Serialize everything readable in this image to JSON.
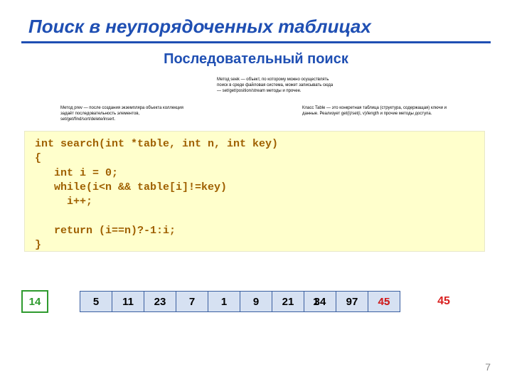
{
  "title": "Поиск в неупорядоченных таблицах",
  "subtitle": "Последовательный поиск",
  "smalltext_top": "Метод seek — объект, по которому можно осуществлять поиск в среде файловая система, может записывать сюда — set/get/position/stream методы и прочее.",
  "smalltext_left": "Метод prev — после создания экземпляра объекта коллекция задаёт последовательность элементов, set/get/find/sort/delete/insert.",
  "smalltext_right": "Класс Table — это конкретная таблица (структура, содержащая) ключи и данные. Реализует get(i)/set(i, v)/length и прочие методы доступа.",
  "code": "int search(int *table, int n, int key)\n{\n   int i = 0;\n   while(i<n && table[i]!=key)\n     i++;\n\n   return (i==n)?-1:i;\n}",
  "key": "14",
  "cells": [
    {
      "value": "5"
    },
    {
      "value": "11"
    },
    {
      "value": "23"
    },
    {
      "value": "7"
    },
    {
      "value": "1"
    },
    {
      "value": "9"
    },
    {
      "value": "21"
    },
    {
      "value": "34",
      "overlay": "1",
      "overlay_dx": -10
    },
    {
      "value": "97"
    },
    {
      "value": "45",
      "overlay": "45",
      "overlay_color": "#d91f1f"
    }
  ],
  "result": "45",
  "page": "7"
}
